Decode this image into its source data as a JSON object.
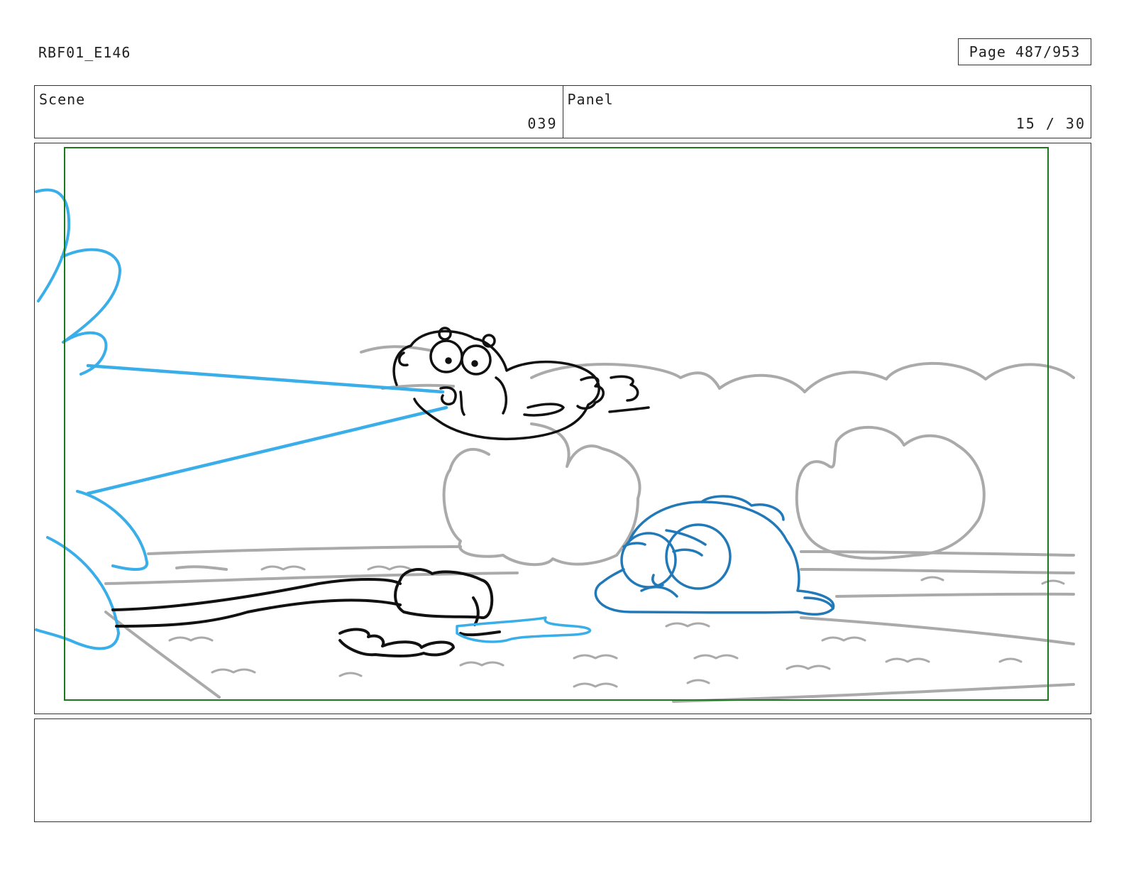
{
  "header": {
    "doc_id": "RBF01_E146",
    "page": "Page 487/953"
  },
  "info": {
    "scene_label": "Scene",
    "scene_number": "039",
    "panel_label": "Panel",
    "panel_number": "15 / 30"
  },
  "notes": {
    "text": ""
  },
  "colors": {
    "safe_frame": "#1a7a1a",
    "background_sketch": "#aaaaaa",
    "character_line": "#111111",
    "tongue_blue": "#3aaee8",
    "fallen_character": "#2279b8"
  }
}
